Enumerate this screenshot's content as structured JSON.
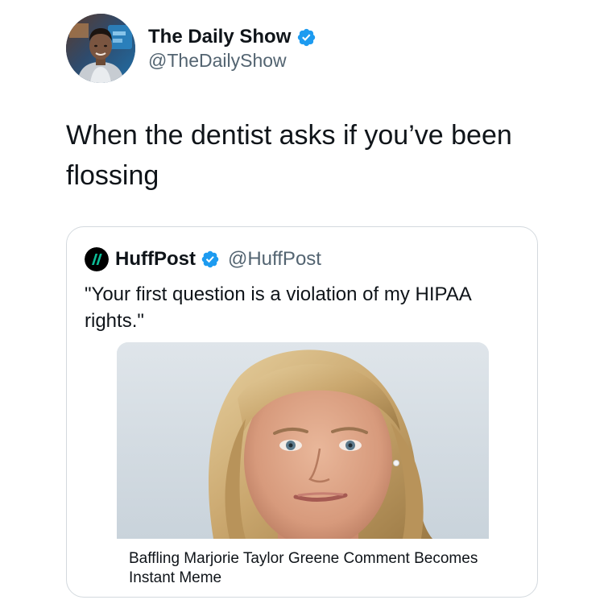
{
  "tweet": {
    "author": {
      "display_name": "The Daily Show",
      "handle": "@TheDailyShow",
      "verified": true,
      "avatar_icon": "person-avatar"
    },
    "text": "When the dentist asks if you’ve been flossing"
  },
  "quoted_tweet": {
    "author": {
      "display_name": "HuffPost",
      "handle": "@HuffPost",
      "verified": true,
      "logo_icon": "huffpost-logo-icon"
    },
    "text": "\"Your first question is a violation of my HIPAA rights.\"",
    "link_card": {
      "image_icon": "woman-portrait-photo",
      "headline": "Baffling Marjorie Taylor Greene Comment Becomes Instant Meme"
    }
  },
  "colors": {
    "text_primary": "#0f1419",
    "text_secondary": "#536471",
    "verified_blue": "#1d9bf0",
    "border": "#d3d9de",
    "huffpost_green": "#0dbe98"
  }
}
